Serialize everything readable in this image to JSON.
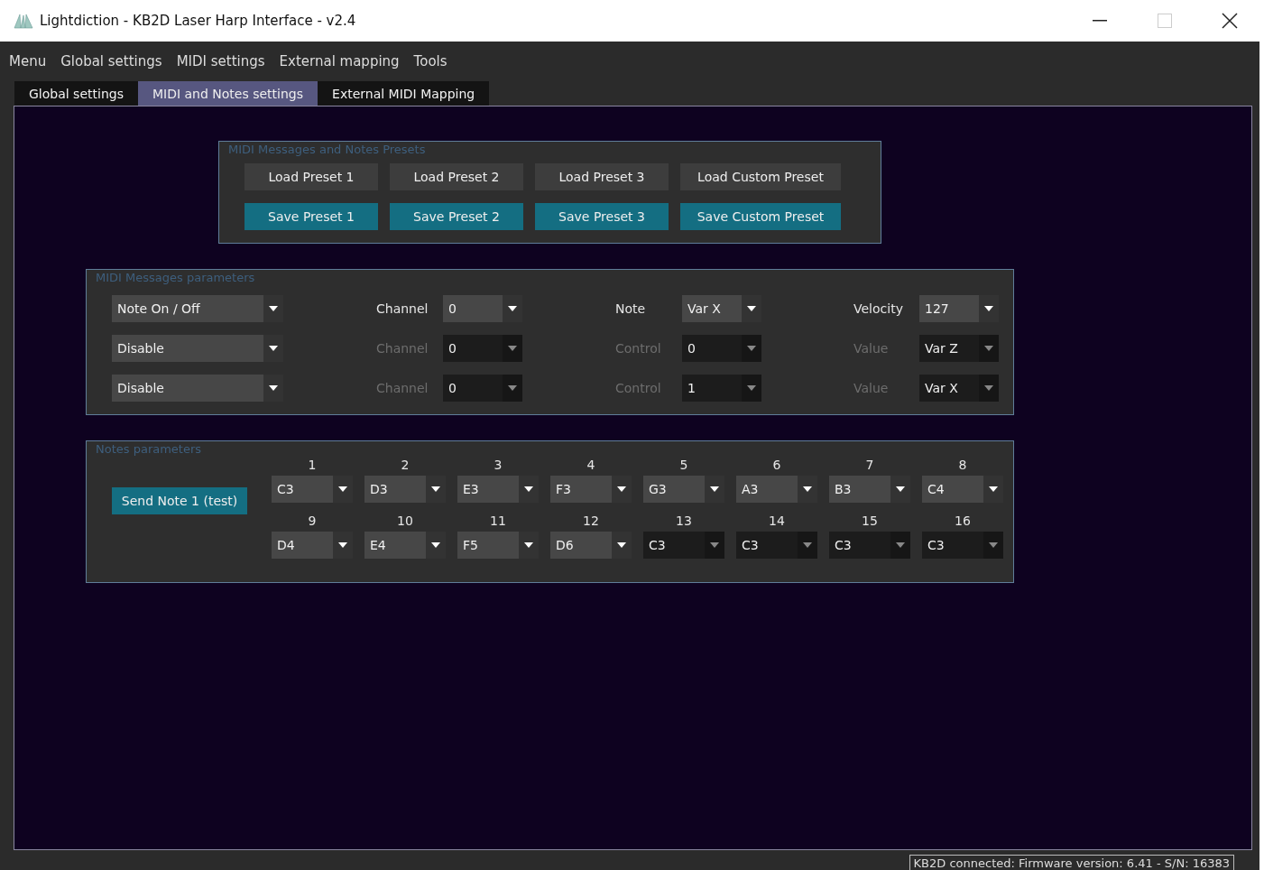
{
  "window": {
    "title": "Lightdiction - KB2D Laser Harp Interface - v2.4"
  },
  "menu": [
    "Menu",
    "Global settings",
    "MIDI settings",
    "External mapping",
    "Tools"
  ],
  "tabs": [
    {
      "label": "Global settings",
      "selected": false
    },
    {
      "label": "MIDI and Notes settings",
      "selected": true
    },
    {
      "label": "External MIDI Mapping",
      "selected": false
    }
  ],
  "presets": {
    "title": "MIDI Messages and Notes Presets",
    "buttons": [
      {
        "label": "Load Preset 1",
        "kind": "load"
      },
      {
        "label": "Load Preset 2",
        "kind": "load"
      },
      {
        "label": "Load Preset 3",
        "kind": "load"
      },
      {
        "label": "Load Custom Preset",
        "kind": "load"
      },
      {
        "label": "Save Preset 1",
        "kind": "save"
      },
      {
        "label": "Save Preset 2",
        "kind": "save"
      },
      {
        "label": "Save Preset 3",
        "kind": "save"
      },
      {
        "label": "Save Custom Preset",
        "kind": "save"
      }
    ]
  },
  "midi_params": {
    "title": "MIDI Messages parameters",
    "rows": [
      {
        "type": "Note On / Off",
        "enabled": true,
        "fields": [
          {
            "label": "Channel",
            "value": "0"
          },
          {
            "label": "Note",
            "value": "Var X"
          },
          {
            "label": "Velocity",
            "value": "127"
          }
        ]
      },
      {
        "type": "Disable",
        "enabled": false,
        "fields": [
          {
            "label": "Channel",
            "value": "0"
          },
          {
            "label": "Control",
            "value": "0"
          },
          {
            "label": "Value",
            "value": "Var Z"
          }
        ]
      },
      {
        "type": "Disable",
        "enabled": false,
        "fields": [
          {
            "label": "Channel",
            "value": "0"
          },
          {
            "label": "Control",
            "value": "1"
          },
          {
            "label": "Value",
            "value": "Var X"
          }
        ]
      }
    ]
  },
  "notes": {
    "title": "Notes parameters",
    "test_button": "Send Note 1 (test)",
    "notes": [
      {
        "number": "1",
        "value": "C3",
        "enabled": true
      },
      {
        "number": "2",
        "value": "D3",
        "enabled": true
      },
      {
        "number": "3",
        "value": "E3",
        "enabled": true
      },
      {
        "number": "4",
        "value": "F3",
        "enabled": true
      },
      {
        "number": "5",
        "value": "G3",
        "enabled": true
      },
      {
        "number": "6",
        "value": "A3",
        "enabled": true
      },
      {
        "number": "7",
        "value": "B3",
        "enabled": true
      },
      {
        "number": "8",
        "value": "C4",
        "enabled": true
      },
      {
        "number": "9",
        "value": "D4",
        "enabled": true
      },
      {
        "number": "10",
        "value": "E4",
        "enabled": true
      },
      {
        "number": "11",
        "value": "F5",
        "enabled": true
      },
      {
        "number": "12",
        "value": "D6",
        "enabled": true
      },
      {
        "number": "13",
        "value": "C3",
        "enabled": false
      },
      {
        "number": "14",
        "value": "C3",
        "enabled": false
      },
      {
        "number": "15",
        "value": "C3",
        "enabled": false
      },
      {
        "number": "16",
        "value": "C3",
        "enabled": false
      }
    ]
  },
  "status_bar": "KB2D connected: Firmware version: 6.41 - S/N: 16383"
}
